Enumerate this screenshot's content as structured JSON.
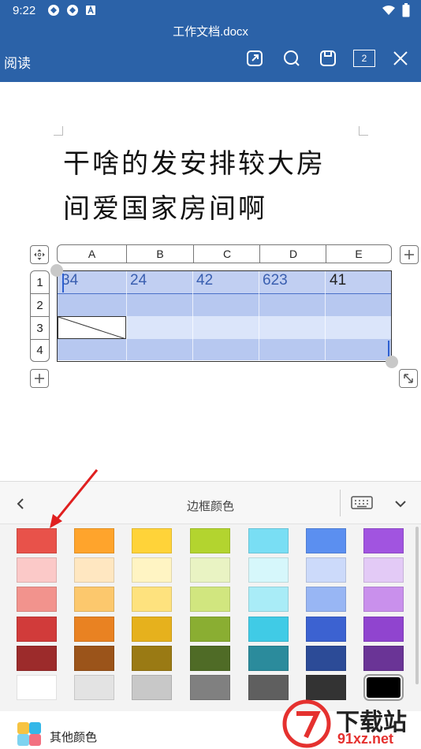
{
  "status_bar": {
    "time": "9:22"
  },
  "header": {
    "title": "工作文档.docx",
    "mode_label": "阅读",
    "page_count": "2"
  },
  "document": {
    "heading_lines": [
      "干啥的发安排较大房",
      "间爱国家房间啊"
    ]
  },
  "table": {
    "column_labels": [
      "A",
      "B",
      "C",
      "D",
      "E"
    ],
    "row_labels": [
      "1",
      "2",
      "3",
      "4"
    ],
    "row1_values": [
      "34",
      "24",
      "42",
      "623",
      "41"
    ]
  },
  "panel": {
    "title": "边框颜色",
    "more_colors_label": "其他颜色",
    "palette": [
      [
        "#e8524a",
        "#ffa42c",
        "#ffd339",
        "#b3d42f",
        "#79def4",
        "#5b8ff0",
        "#a154e0"
      ],
      [
        "#fbc9c8",
        "#ffe7c1",
        "#fff4c3",
        "#e9f3c3",
        "#d6f7fb",
        "#ccdafa",
        "#e3caf6"
      ],
      [
        "#f2938d",
        "#fcc86d",
        "#fee27e",
        "#d1e67f",
        "#a9ecf7",
        "#98b6f4",
        "#c990ec"
      ],
      [
        "#d13b3a",
        "#e98222",
        "#e6b11d",
        "#8aae32",
        "#40cbe6",
        "#3c62d1",
        "#9044cf"
      ],
      [
        "#9c2b2b",
        "#9b541a",
        "#9a7a14",
        "#4f6b26",
        "#2b8b9c",
        "#2c4b97",
        "#6a3496"
      ],
      [
        "#ffffff",
        "#e3e3e3",
        "#c8c8c8",
        "#808080",
        "#5f5f5f",
        "#333333",
        "#000000"
      ]
    ]
  },
  "watermark": {
    "line1": "下载站",
    "line2": "91xz.net"
  },
  "colors": {
    "header": "#2b62a8",
    "selection": "#c1cff2",
    "arrow": "#e02020"
  }
}
